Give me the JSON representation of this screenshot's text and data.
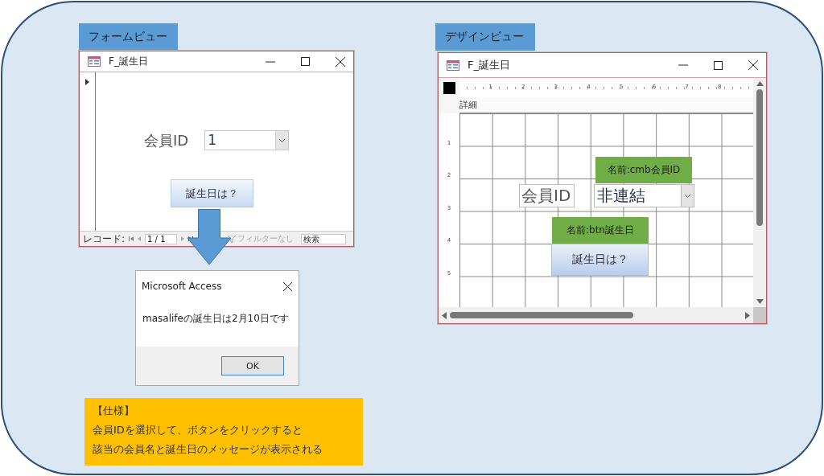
{
  "form_view": {
    "label": "フォームビュー",
    "window": {
      "title": "F_誕生日"
    },
    "field": {
      "label": "会員ID",
      "value": "1"
    },
    "button": "誕生日は？",
    "navigation": {
      "label": "レコード:",
      "position": "1 / 1",
      "filter": {
        "label": "フィルターなし",
        "disabled": true
      },
      "search": {
        "placeholder": "検索"
      }
    }
  },
  "dialog": {
    "title": "Microsoft Access",
    "message": "masalifeの誕生日は2月10日です",
    "button": "OK"
  },
  "design_view": {
    "label": "デザインビュー",
    "window": {
      "title": "F_誕生日"
    },
    "ruler": {
      "horizontal": [
        "1",
        "2",
        "3",
        "4",
        "5",
        "6",
        "7",
        "8"
      ],
      "vertical": [
        "1",
        "2",
        "3",
        "4",
        "5"
      ]
    },
    "section": "詳細",
    "label_control": "会員ID",
    "combo": {
      "value": "非連結"
    },
    "button": "誕生日は？",
    "name_tags": [
      "名前:cmb会員ID",
      "名前:btn誕生日"
    ]
  },
  "spec": {
    "title": "【仕様】",
    "lines": [
      "会員IDを選択して、ボタンをクリックすると",
      "該当の会員名と誕生日のメッセージが表示される"
    ]
  }
}
